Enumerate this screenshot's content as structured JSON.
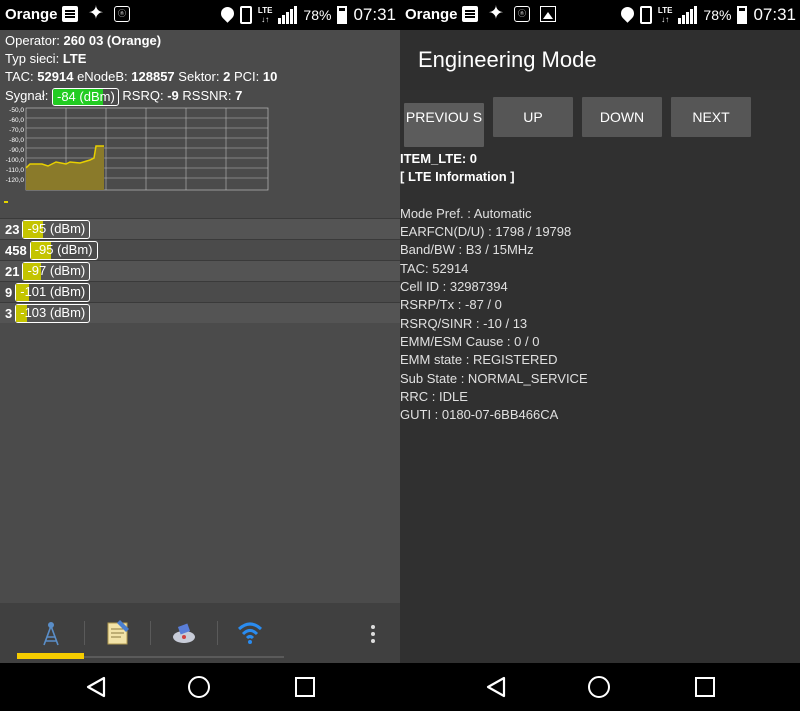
{
  "left_screen": {
    "status_bar": {
      "carrier": "Orange",
      "battery": "78%",
      "time": "07:31",
      "network": "LTE"
    },
    "info": {
      "operator_label": "Operator:",
      "operator_value": "260 03 (Orange)",
      "network_type_label": "Typ sieci:",
      "network_type_value": "LTE",
      "tac_label": "TAC:",
      "tac_value": "52914",
      "enodeb_label": "eNodeB:",
      "enodeb_value": "128857",
      "sector_label": "Sektor:",
      "sector_value": "2",
      "pci_label": "PCI:",
      "pci_value": "10",
      "signal_label": "Sygnał:",
      "signal_value": "-84 (dBm)",
      "rsrq_label": "RSRQ:",
      "rsrq_value": "-9",
      "rssnr_label": "RSSNR:",
      "rssnr_value": "7"
    },
    "chart": {
      "y_ticks": [
        "-50,0",
        "-60,0",
        "-70,0",
        "-80,0",
        "-90,0",
        "-100,0",
        "-110,0",
        "-120,0"
      ],
      "fill_color": "#8a7a2a",
      "line_color": "#e8d000"
    },
    "neighbor_cells": [
      {
        "id": "23",
        "signal": "-95 (dBm)",
        "level": 0.3
      },
      {
        "id": "458",
        "signal": "-95 (dBm)",
        "level": 0.3
      },
      {
        "id": "21",
        "signal": "-97 (dBm)",
        "level": 0.28
      },
      {
        "id": "9",
        "signal": "-101 (dBm)",
        "level": 0.23
      },
      {
        "id": "3",
        "signal": "-103 (dBm)",
        "level": 0.2
      }
    ],
    "signal_fill_color": "#22cc22",
    "toolbar": [
      "tower-icon",
      "notepad-icon",
      "satellite-map-icon",
      "wifi-icon",
      "more-icon"
    ]
  },
  "right_screen": {
    "status_bar": {
      "carrier": "Orange",
      "battery": "78%",
      "time": "07:31",
      "network": "LTE"
    },
    "title": "Engineering Mode",
    "buttons": {
      "previous": "PREVIOU S",
      "up": "UP",
      "down": "DOWN",
      "next": "NEXT"
    },
    "item_label": "ITEM_LTE: 0",
    "section_label": "[ LTE Information ]",
    "lines": [
      "Mode Pref. : Automatic",
      "EARFCN(D/U) :  1798 / 19798",
      "Band/BW :  B3 / 15MHz",
      "TAC:  52914",
      "Cell ID :  32987394",
      "RSRP/Tx :  -87 / 0",
      "RSRQ/SINR :  -10 / 13",
      "EMM/ESM Cause :  0 / 0",
      "EMM state :  REGISTERED",
      "Sub State :  NORMAL_SERVICE",
      "RRC :  IDLE",
      "GUTI :  0180-07-6BB466CA"
    ]
  }
}
